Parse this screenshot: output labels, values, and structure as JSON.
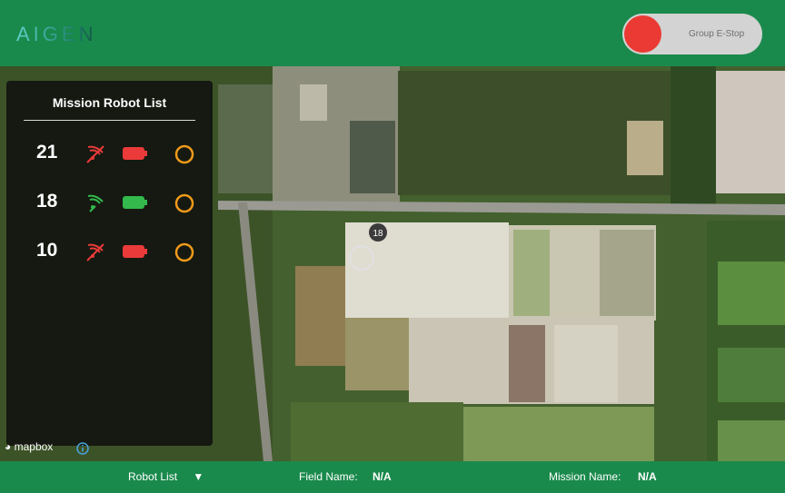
{
  "header": {
    "brand_logo": "AIGEN",
    "estop_label": "Group E-Stop",
    "colors": {
      "brand": "#1a8a4c",
      "estop": "#ea3a33"
    }
  },
  "panel": {
    "title": "Mission Robot List",
    "robots": [
      {
        "id": "21",
        "signal_icon": "signal-lost-icon",
        "signal_color": "#ea3a3a",
        "battery_icon": "battery-icon",
        "battery_color": "#ea3a3a",
        "status_icon": "status-ring-icon"
      },
      {
        "id": "18",
        "signal_icon": "signal-icon",
        "signal_color": "#33b94c",
        "battery_icon": "battery-icon",
        "battery_color": "#33b94c",
        "status_icon": "status-ring-icon"
      },
      {
        "id": "10",
        "signal_icon": "signal-lost-icon",
        "signal_color": "#ea3a3a",
        "battery_icon": "battery-icon",
        "battery_color": "#ea3a3a",
        "status_icon": "status-ring-icon"
      }
    ]
  },
  "map": {
    "marker_label": "18",
    "attribution": "mapbox"
  },
  "bottom": {
    "robot_list_label": "Robot List",
    "field_label": "Field Name:",
    "field_value": "N/A",
    "mission_label": "Mission Name:",
    "mission_value": "N/A"
  }
}
